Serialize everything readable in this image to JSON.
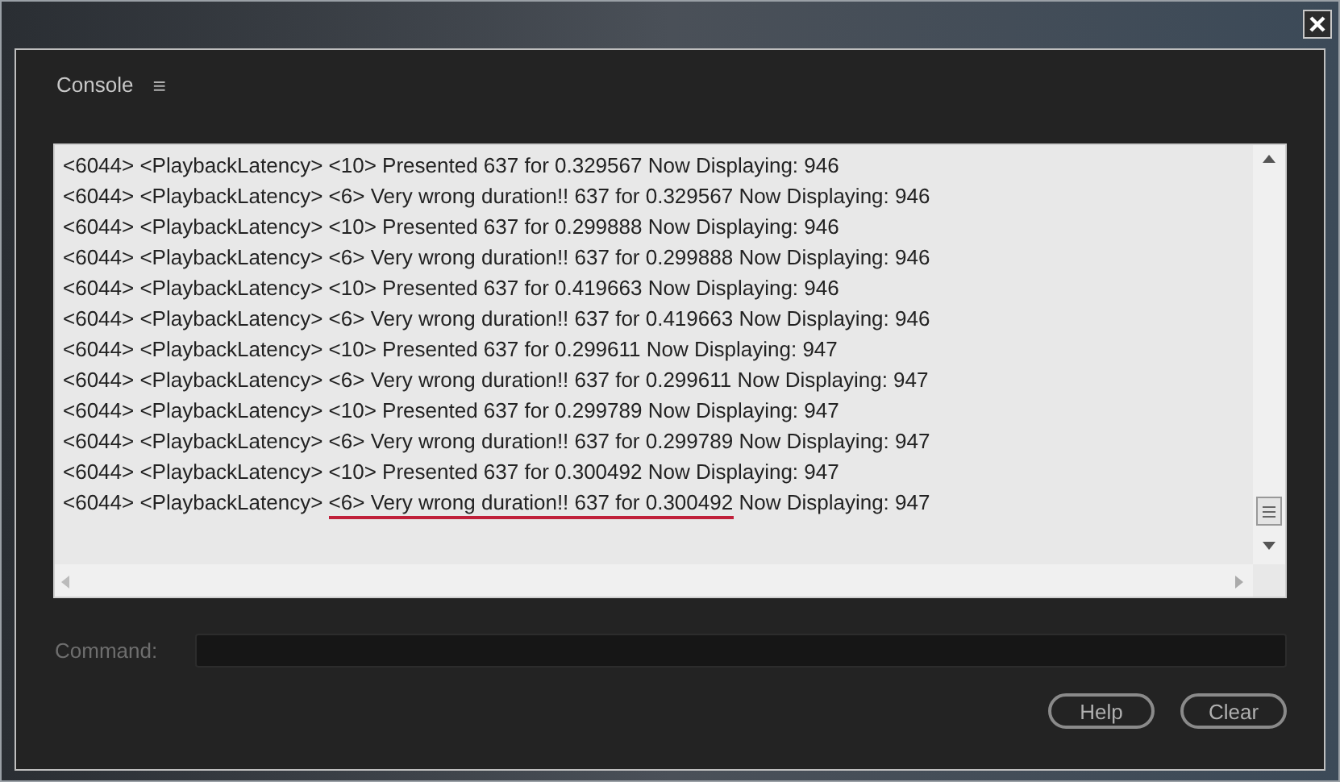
{
  "panel": {
    "title": "Console",
    "menu_glyph": "≡"
  },
  "log": [
    {
      "parts": [
        {
          "text": "<6044> <PlaybackLatency> <10> Presented 637 for 0.329567 Now Displaying: 946",
          "underlined": false
        }
      ]
    },
    {
      "parts": [
        {
          "text": "<6044> <PlaybackLatency> <6> Very wrong duration!! 637 for 0.329567 Now Displaying: 946",
          "underlined": false
        }
      ]
    },
    {
      "parts": [
        {
          "text": "<6044> <PlaybackLatency> <10> Presented 637 for 0.299888 Now Displaying: 946",
          "underlined": false
        }
      ]
    },
    {
      "parts": [
        {
          "text": "<6044> <PlaybackLatency> <6> Very wrong duration!! 637 for 0.299888 Now Displaying: 946",
          "underlined": false
        }
      ]
    },
    {
      "parts": [
        {
          "text": "<6044> <PlaybackLatency> <10> Presented 637 for 0.419663 Now Displaying: 946",
          "underlined": false
        }
      ]
    },
    {
      "parts": [
        {
          "text": "<6044> <PlaybackLatency> <6> Very wrong duration!! 637 for 0.419663 Now Displaying: 946",
          "underlined": false
        }
      ]
    },
    {
      "parts": [
        {
          "text": "<6044> <PlaybackLatency> <10> Presented 637 for 0.299611 Now Displaying: 947",
          "underlined": false
        }
      ]
    },
    {
      "parts": [
        {
          "text": "<6044> <PlaybackLatency> <6> Very wrong duration!! 637 for 0.299611 Now Displaying: 947",
          "underlined": false
        }
      ]
    },
    {
      "parts": [
        {
          "text": "<6044> <PlaybackLatency> <10> Presented 637 for 0.299789 Now Displaying: 947",
          "underlined": false
        }
      ]
    },
    {
      "parts": [
        {
          "text": "<6044> <PlaybackLatency> <6> Very wrong duration!! 637 for 0.299789 Now Displaying: 947",
          "underlined": false
        }
      ]
    },
    {
      "parts": [
        {
          "text": "<6044> <PlaybackLatency> <10> Presented 637 for 0.300492 Now Displaying: 947",
          "underlined": false
        }
      ]
    },
    {
      "parts": [
        {
          "text": "<6044> <PlaybackLatency> ",
          "underlined": false
        },
        {
          "text": "<6> Very wrong duration!! 637 for 0.300492",
          "underlined": true
        },
        {
          "text": " Now Displaying: 947",
          "underlined": false
        }
      ]
    }
  ],
  "command": {
    "label": "Command:"
  },
  "buttons": [
    "Help",
    "Clear"
  ]
}
